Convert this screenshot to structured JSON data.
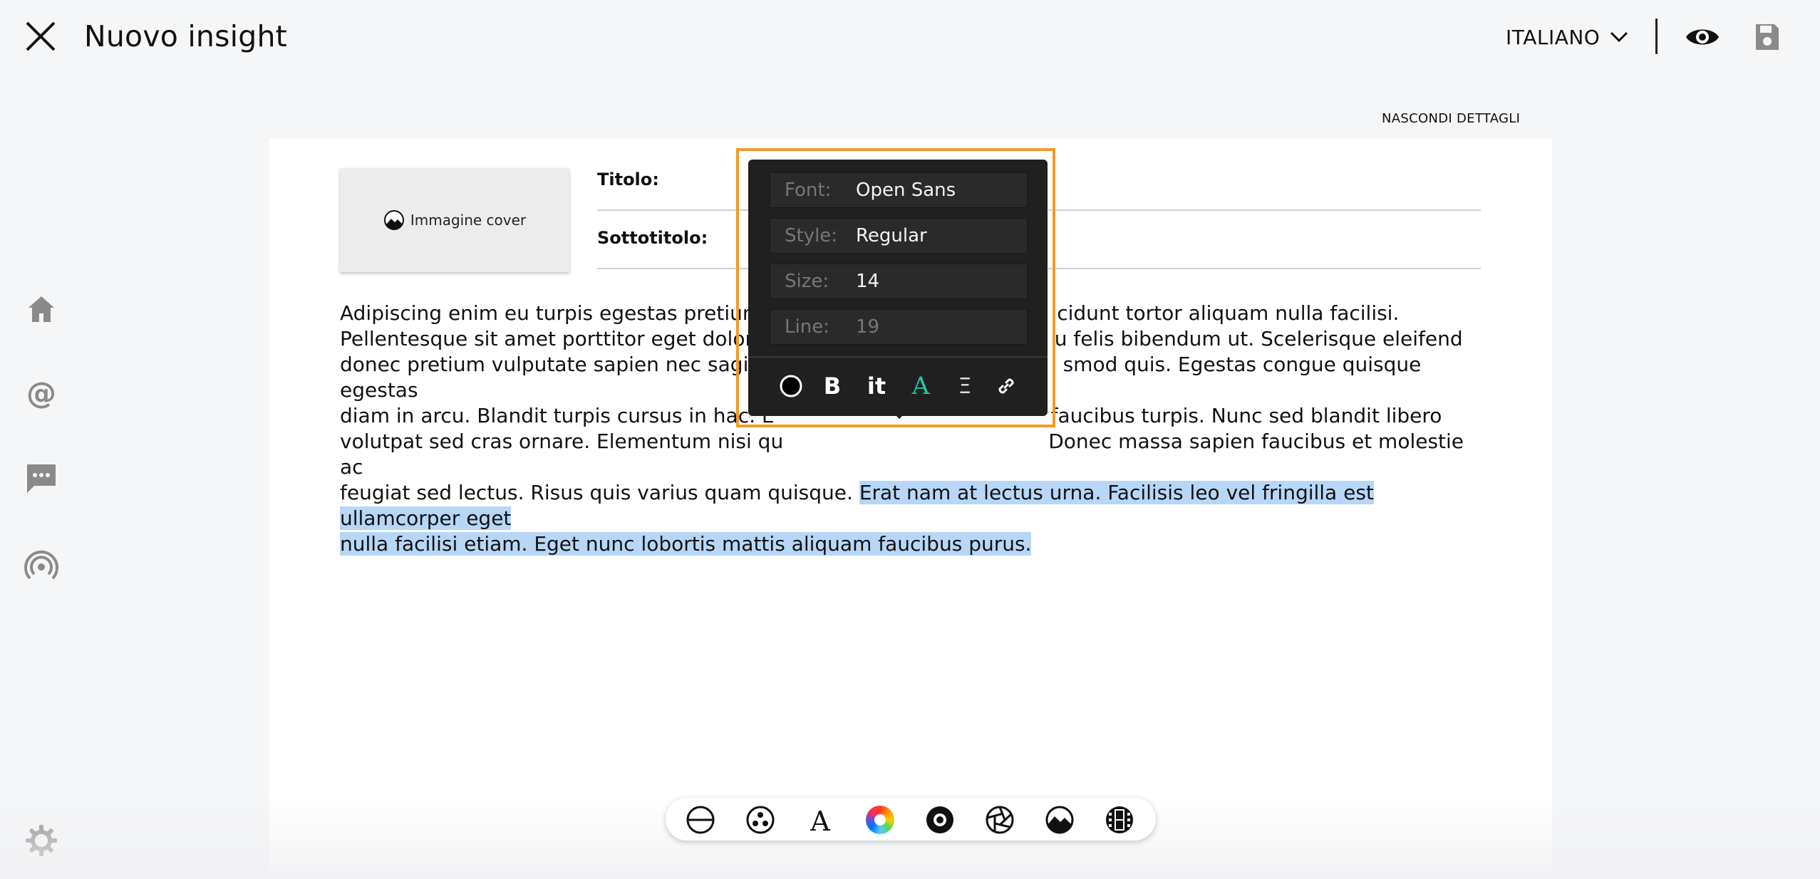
{
  "header": {
    "title": "Nuovo insight",
    "language": "ITALIANO",
    "hide_details": "NASCONDI DETTAGLI"
  },
  "sidebar": {
    "items": [
      {
        "icon": "home-icon"
      },
      {
        "icon": "at-icon"
      },
      {
        "icon": "chat-icon"
      },
      {
        "icon": "broadcast-icon"
      },
      {
        "icon": "gear-icon"
      }
    ]
  },
  "document": {
    "cover_label": "Immagine cover",
    "title_label": "Titolo:",
    "subtitle_label": "Sottotitolo:",
    "title_value": "",
    "subtitle_value": "",
    "body_lines": [
      "Adipiscing enim eu turpis egestas pretium a",
      "cidunt tortor aliquam nulla facilisi.",
      "Pellentesque sit amet porttitor eget dolor. C",
      "u felis bibendum ut. Scelerisque eleifend",
      "donec pretium vulputate sapien nec sagittis.",
      "smod quis. Egestas congue quisque egestas",
      "diam in arcu. Blandit turpis cursus in hac. E",
      "faucibus turpis. Nunc sed blandit libero",
      "volutpat sed cras ornare. Elementum nisi qu",
      "Donec massa sapien faucibus et molestie ac",
      "feugiat sed lectus. Risus quis varius quam quisque. "
    ],
    "selected_text_1": "Erat nam at lectus urna. Facilisis leo vel fringilla est ullamcorper eget",
    "selected_text_2": "nulla facilisi etiam. Eget nunc lobortis mattis aliquam faucibus purus."
  },
  "format_popover": {
    "rows": [
      {
        "key": "Font:",
        "value": "Open Sans"
      },
      {
        "key": "Style:",
        "value": "Regular"
      },
      {
        "key": "Size:",
        "value": "14"
      },
      {
        "key": "Line:",
        "value": "19"
      }
    ],
    "buttons": {
      "bold": "B",
      "italic": "it",
      "font_color": "A",
      "align": "Ξ"
    },
    "accent_color": "#1fc8a6",
    "highlight_color": "#f39a2b"
  },
  "bottom_toolbar": {
    "icons": [
      "divider-icon",
      "molecule-icon",
      "text-icon",
      "color-wheel-icon",
      "record-icon",
      "aperture-icon",
      "image-icon",
      "film-icon"
    ]
  }
}
